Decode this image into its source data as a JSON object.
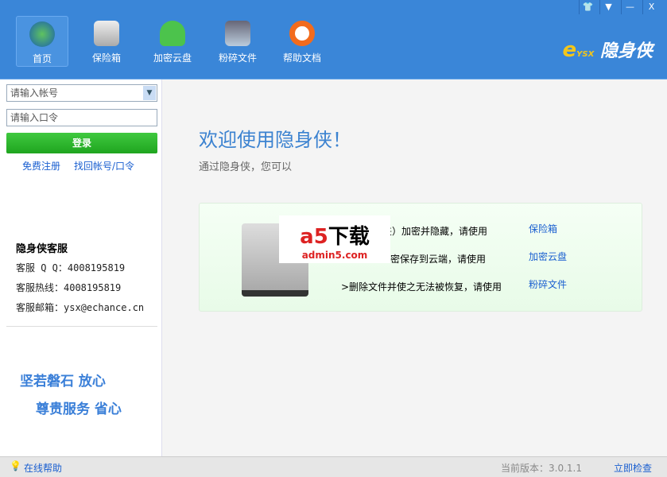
{
  "window_controls": [
    "skin",
    "menu",
    "minimize",
    "close"
  ],
  "nav": [
    {
      "label": "首页",
      "icon": "globe-icon"
    },
    {
      "label": "保险箱",
      "icon": "safe-icon"
    },
    {
      "label": "加密云盘",
      "icon": "cloud-icon"
    },
    {
      "label": "粉碎文件",
      "icon": "shredder-icon"
    },
    {
      "label": "帮助文档",
      "icon": "lifebuoy-icon"
    }
  ],
  "logo": {
    "e": "e",
    "text": "隐身侠",
    "mark": "YSX"
  },
  "login": {
    "account_placeholder": "请输入帐号",
    "password_placeholder": "请输入口令",
    "login_button": "登录",
    "register": "免费注册",
    "recover": "找回帐号/口令"
  },
  "service": {
    "title": "隐身侠客服",
    "qq": "客服 Q Q：4008195819",
    "hotline": "客服热线：4008195819",
    "email": "客服邮箱：ysx@echance.cn"
  },
  "slogans": [
    "坚若磐石  放心",
    "尊贵服务  省心"
  ],
  "main": {
    "welcome": "欢迎使用隐身侠！",
    "subtitle": "通过隐身侠，您可以",
    "rows": [
      {
        "text": "夹）加密并隐藏，请使用",
        "link": "保险箱"
      },
      {
        "text": "密保存到云端，请使用",
        "link": "加密云盘"
      },
      {
        "text": ">删除文件并使之无法被恢复，请使用",
        "link": "粉碎文件"
      }
    ],
    "watermark": {
      "brand": "a5",
      "cn": "下载",
      "domain": "admin5.com"
    }
  },
  "status": {
    "help": "在线帮助",
    "version": "当前版本：3.0.1.1",
    "check": "立即检查"
  }
}
